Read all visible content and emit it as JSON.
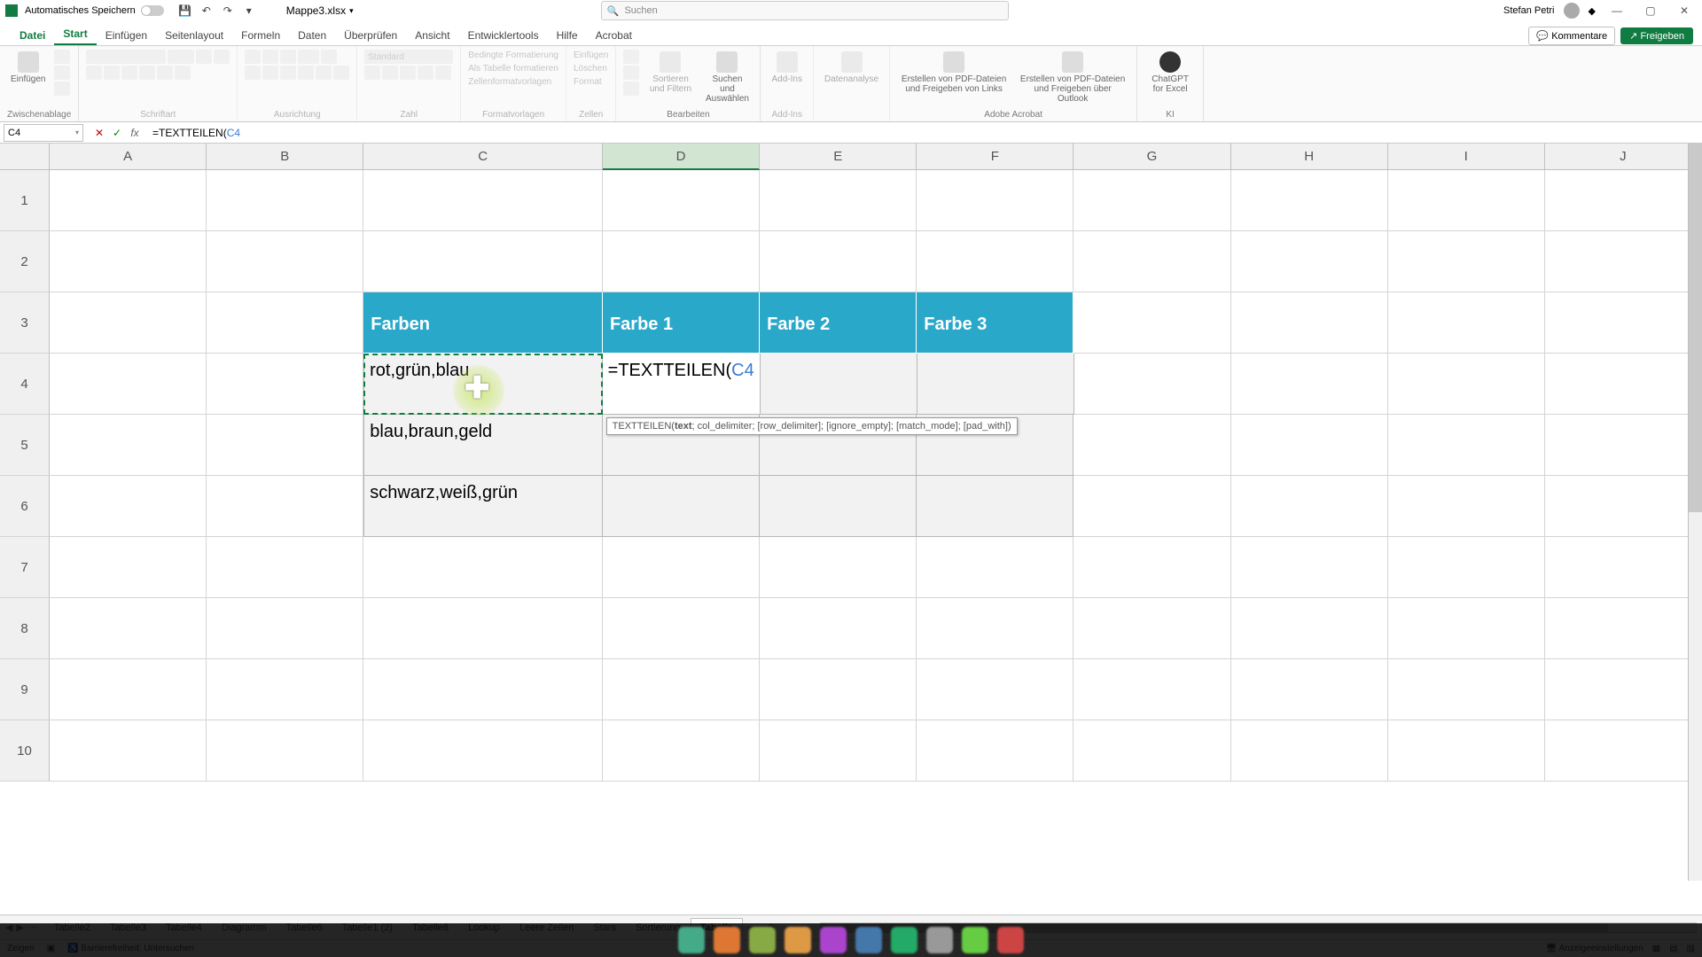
{
  "title": {
    "autosave": "Automatisches Speichern",
    "filename": "Mappe3.xlsx",
    "search_placeholder": "Suchen",
    "user": "Stefan Petri"
  },
  "tabs": {
    "file": "Datei",
    "start": "Start",
    "insert": "Einfügen",
    "pagelayout": "Seitenlayout",
    "formulas": "Formeln",
    "data": "Daten",
    "review": "Überprüfen",
    "view": "Ansicht",
    "developer": "Entwicklertools",
    "help": "Hilfe",
    "acrobat": "Acrobat",
    "comments": "Kommentare",
    "share": "Freigeben"
  },
  "ribbon": {
    "paste": "Einfügen",
    "clipboard": "Zwischenablage",
    "font": "Schriftart",
    "alignment": "Ausrichtung",
    "number": "Zahl",
    "styles": "Formatvorlagen",
    "cond_format": "Bedingte Formatierung",
    "as_table": "Als Tabelle formatieren",
    "cell_styles": "Zellenformatvorlagen",
    "cells": "Zellen",
    "insert_cells": "Einfügen",
    "delete_cells": "Löschen",
    "format_cells": "Format",
    "editing": "Bearbeiten",
    "sort": "Sortieren und Filtern",
    "find": "Suchen und Auswählen",
    "addins": "Add-Ins",
    "addins_btn": "Add-Ins",
    "analysis": "Datenanalyse",
    "acrobat_grp": "Adobe Acrobat",
    "acro1": "Erstellen von PDF-Dateien und Freigeben von Links",
    "acro2": "Erstellen von PDF-Dateien und Freigeben über Outlook",
    "ai": "KI",
    "gpt": "ChatGPT for Excel",
    "number_format": "Standard"
  },
  "formula_bar": {
    "name_box": "C4",
    "formula_prefix": "=TEXTTEILEN(",
    "formula_ref": "C4"
  },
  "columns": [
    "A",
    "B",
    "C",
    "D",
    "E",
    "F",
    "G",
    "H",
    "I",
    "J"
  ],
  "rows": [
    "1",
    "2",
    "3",
    "4",
    "5",
    "6",
    "7",
    "8",
    "9",
    "10"
  ],
  "table": {
    "header": [
      "Farben",
      "Farbe 1",
      "Farbe 2",
      "Farbe 3"
    ],
    "body": [
      [
        "rot,grün,blau",
        "=TEXTTEILEN(",
        "",
        ""
      ],
      [
        "blau,braun,geld",
        "",
        "",
        ""
      ],
      [
        "schwarz,weiß,grün",
        "",
        "",
        ""
      ]
    ],
    "editing_ref": "C4"
  },
  "tooltip": {
    "fn": "TEXTTEILEN(",
    "bold_arg": "text",
    "rest": "; col_delimiter; [row_delimiter]; [ignore_empty]; [match_mode]; [pad_with])"
  },
  "sheets": [
    "Tabelle2",
    "Tabelle3",
    "Tabelle4",
    "Diagramm",
    "Tabelle6",
    "Tabelle1 (2)",
    "Tabelle8",
    "Lookup",
    "Leere Zeilen",
    "Stars",
    "Sortierung",
    "Tabelle"
  ],
  "active_sheet": "Tabelle",
  "status": {
    "mode": "Zeigen",
    "access": "Barrierefreiheit: Untersuchen",
    "display": "Anzeigeeinstellungen"
  },
  "chart_data": null
}
